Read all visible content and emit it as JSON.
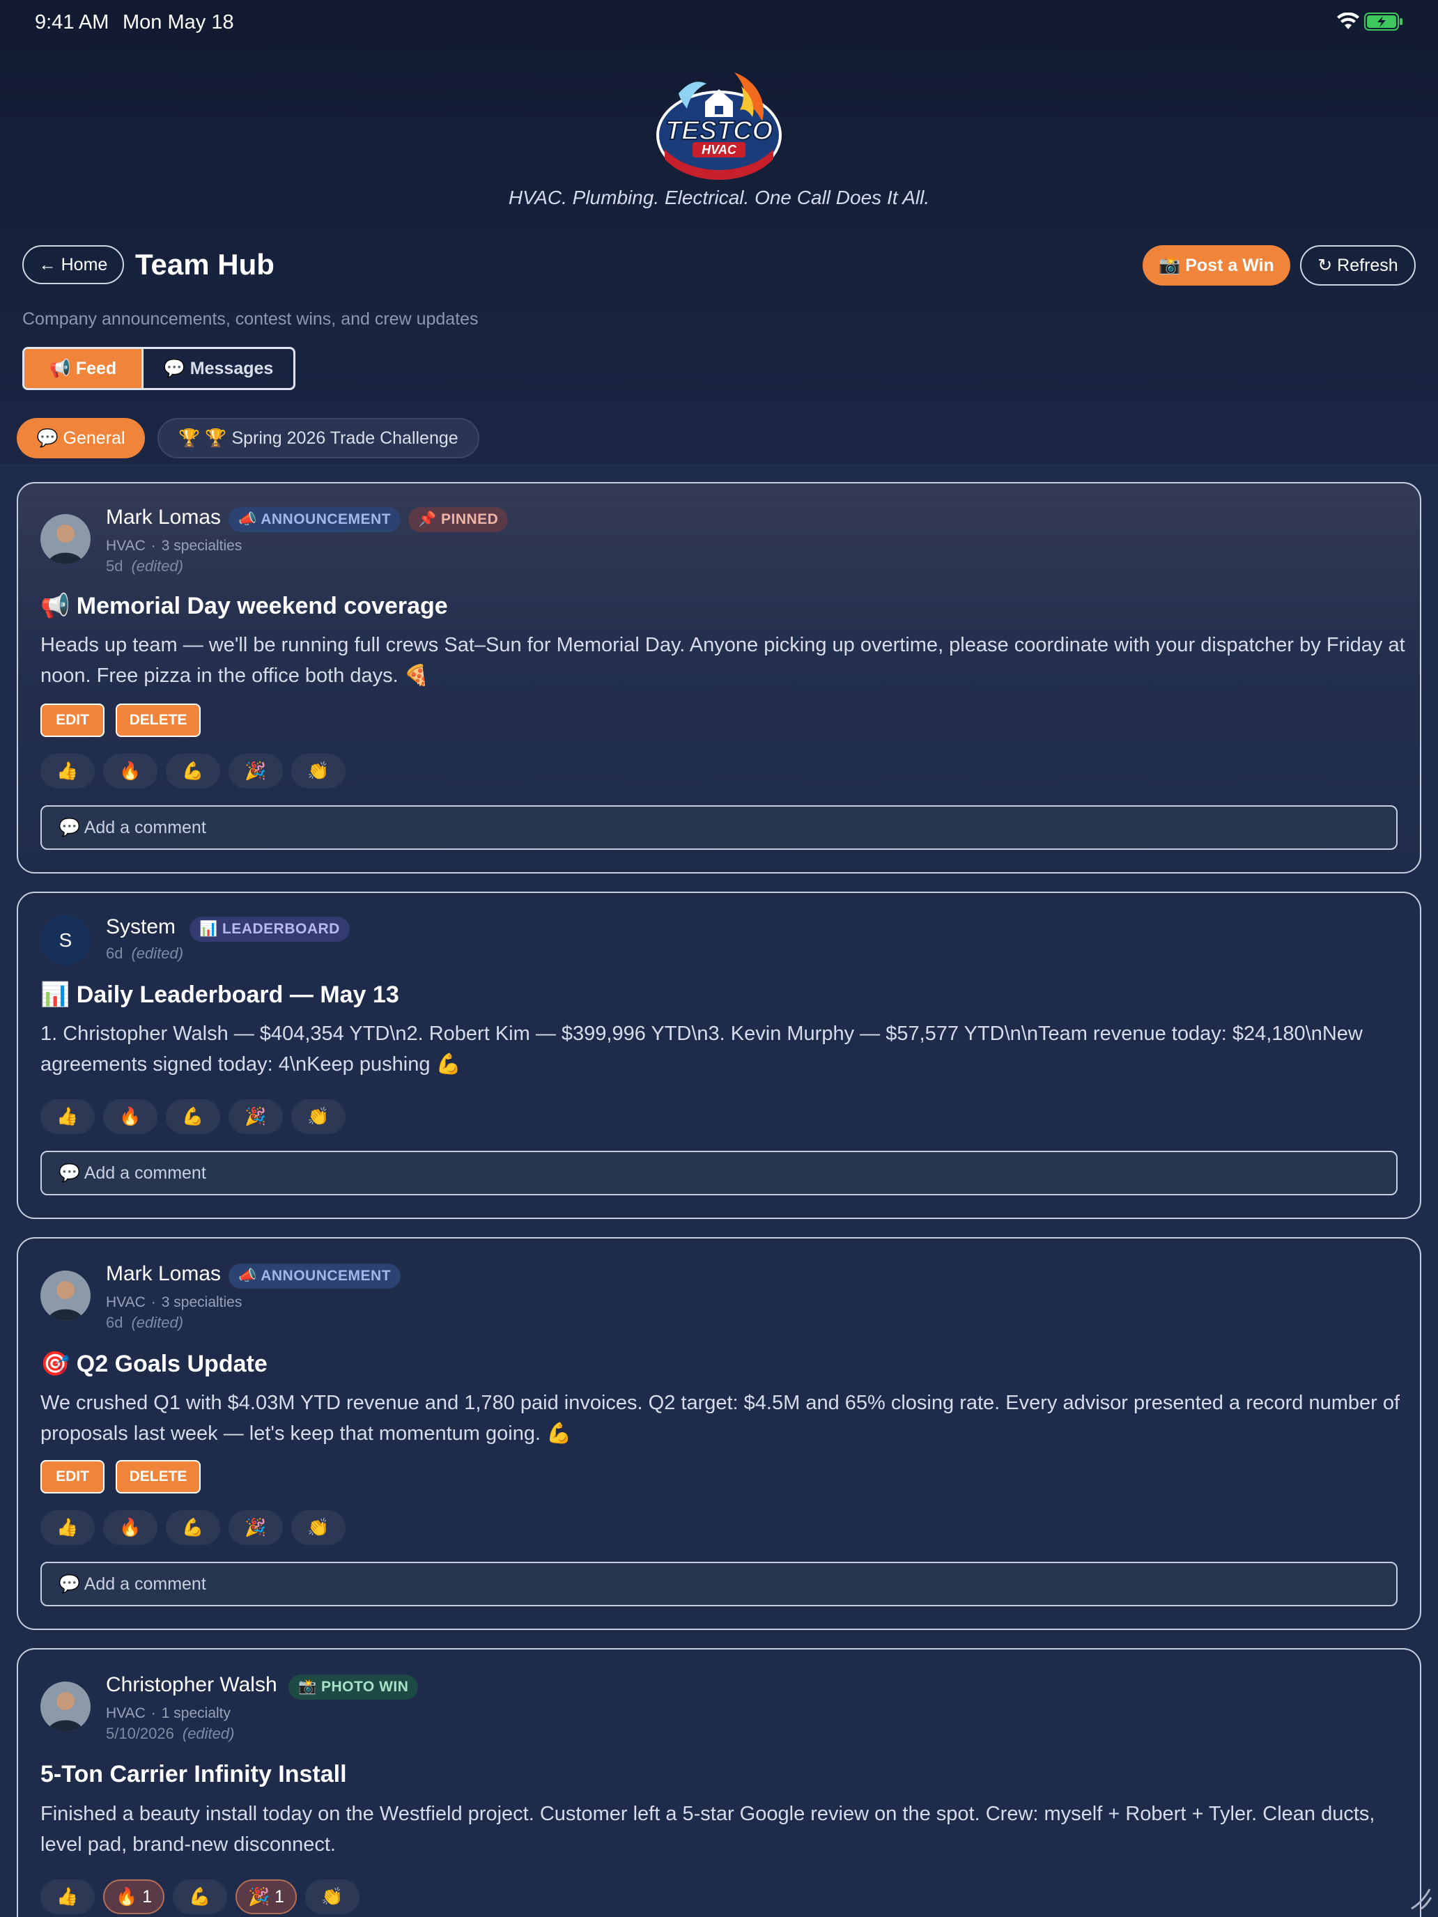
{
  "status_bar": {
    "time": "9:41 AM",
    "date": "Mon May 18"
  },
  "brand": {
    "tagline": "HVAC. Plumbing. Electrical. One Call Does It All.",
    "logo_text": "TESTCO",
    "logo_sub": "HVAC"
  },
  "header": {
    "home_label": "← Home",
    "title": "Team Hub",
    "subtitle": "Company announcements, contest wins, and crew updates",
    "post_win_label": "📸 Post a Win",
    "refresh_label": "↻ Refresh"
  },
  "tabs": {
    "feed": "📢 Feed",
    "messages": "💬 Messages"
  },
  "channels": {
    "general": "💬 General",
    "challenge": "🏆 🏆 Spring 2026 Trade Challenge"
  },
  "comment_placeholder": "💬 Add a comment",
  "edit_label": "EDIT",
  "delete_label": "DELETE",
  "posts": [
    {
      "author": "Mark Lomas",
      "badges": [
        "📣 ANNOUNCEMENT",
        "📌 PINNED"
      ],
      "trade": "HVAC",
      "specialties": "3 specialties",
      "time": "5d",
      "edited": "(edited)",
      "title": "📢 Memorial Day weekend coverage",
      "body": "Heads up team — we'll be running full crews Sat–Sun for Memorial Day. Anyone picking up overtime, please coordinate with your dispatcher by Friday at noon. Free pizza in the office both days. 🍕",
      "reactions": [
        "👍",
        "🔥",
        "💪",
        "🎉",
        "👏"
      ]
    },
    {
      "author": "System",
      "avatar_letter": "S",
      "badges": [
        "📊 LEADERBOARD"
      ],
      "time": "6d",
      "edited": "(edited)",
      "title": "📊 Daily Leaderboard — May 13",
      "body": "1. Christopher Walsh — $404,354 YTD\\n2. Robert Kim — $399,996 YTD\\n3. Kevin Murphy — $57,577 YTD\\n\\nTeam revenue today: $24,180\\nNew agreements signed today: 4\\nKeep pushing 💪",
      "reactions": [
        "👍",
        "🔥",
        "💪",
        "🎉",
        "👏"
      ]
    },
    {
      "author": "Mark Lomas",
      "badges": [
        "📣 ANNOUNCEMENT"
      ],
      "trade": "HVAC",
      "specialties": "3 specialties",
      "time": "6d",
      "edited": "(edited)",
      "title": "🎯 Q2 Goals Update",
      "body": "We crushed Q1 with $4.03M YTD revenue and 1,780 paid invoices. Q2 target: $4.5M and 65% closing rate. Every advisor presented a record number of proposals last week — let's keep that momentum going. 💪",
      "reactions": [
        "👍",
        "🔥",
        "💪",
        "🎉",
        "👏"
      ]
    },
    {
      "author": "Christopher Walsh",
      "badges": [
        "📸 PHOTO WIN"
      ],
      "trade": "HVAC",
      "specialties": "1 specialty",
      "time": "5/10/2026",
      "edited": "(edited)",
      "title": "5-Ton Carrier Infinity Install",
      "body": "Finished a beauty install today on the Westfield project. Customer left a 5-star Google review on the spot. Crew: myself + Robert + Tyler. Clean ducts, level pad, brand-new disconnect.",
      "reactions": [
        "👍",
        "🔥 1",
        "💪",
        "🎉 1",
        "👏"
      ]
    }
  ],
  "colors": {
    "accent": "#f0843a",
    "background": "#1f2b4a",
    "header_bg": "#111a30"
  }
}
